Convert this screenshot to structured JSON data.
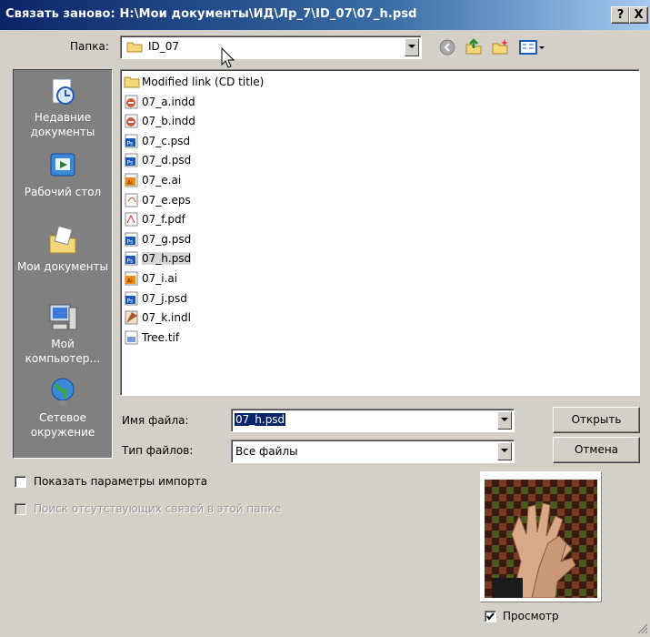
{
  "window": {
    "title": "Связать заново: H:\\Мои документы\\ИД\\Лр_7\\ID_07\\07_h.psd",
    "help_label": "?",
    "close_label": "X"
  },
  "toolbar": {
    "folder_label": "Папка:",
    "folder_value": "ID_07"
  },
  "places": [
    {
      "label": "Недавние документы",
      "icon": "recent-documents-icon"
    },
    {
      "label": "Рабочий стол",
      "icon": "desktop-icon"
    },
    {
      "label": "Мои документы",
      "icon": "my-documents-icon"
    },
    {
      "label": "Мой компьютер…",
      "icon": "my-computer-icon"
    },
    {
      "label": "Сетевое окружение",
      "icon": "network-icon"
    }
  ],
  "files": [
    {
      "name": "Modified link (CD title)",
      "type": "folder"
    },
    {
      "name": "07_a.indd",
      "type": "indd"
    },
    {
      "name": "07_b.indd",
      "type": "indd"
    },
    {
      "name": "07_c.psd",
      "type": "psd"
    },
    {
      "name": "07_d.psd",
      "type": "psd"
    },
    {
      "name": "07_e.ai",
      "type": "ai"
    },
    {
      "name": "07_e.eps",
      "type": "eps"
    },
    {
      "name": "07_f.pdf",
      "type": "pdf"
    },
    {
      "name": "07_g.psd",
      "type": "psd"
    },
    {
      "name": "07_h.psd",
      "type": "psd",
      "selected": true
    },
    {
      "name": "07_i.ai",
      "type": "ai"
    },
    {
      "name": "07_j.psd",
      "type": "psd"
    },
    {
      "name": "07_k.indl",
      "type": "indl"
    },
    {
      "name": "Tree.tif",
      "type": "tif"
    }
  ],
  "filename": {
    "label": "Имя файла:",
    "value": "07_h.psd"
  },
  "filetype": {
    "label": "Тип файлов:",
    "value": "Все файлы"
  },
  "buttons": {
    "open": "Открыть",
    "cancel": "Отмена"
  },
  "options": {
    "show_import": "Показать параметры импорта",
    "find_missing": "Поиск отсутствующих связей в этой папке"
  },
  "preview": {
    "label": "Просмотр",
    "checked": true
  }
}
